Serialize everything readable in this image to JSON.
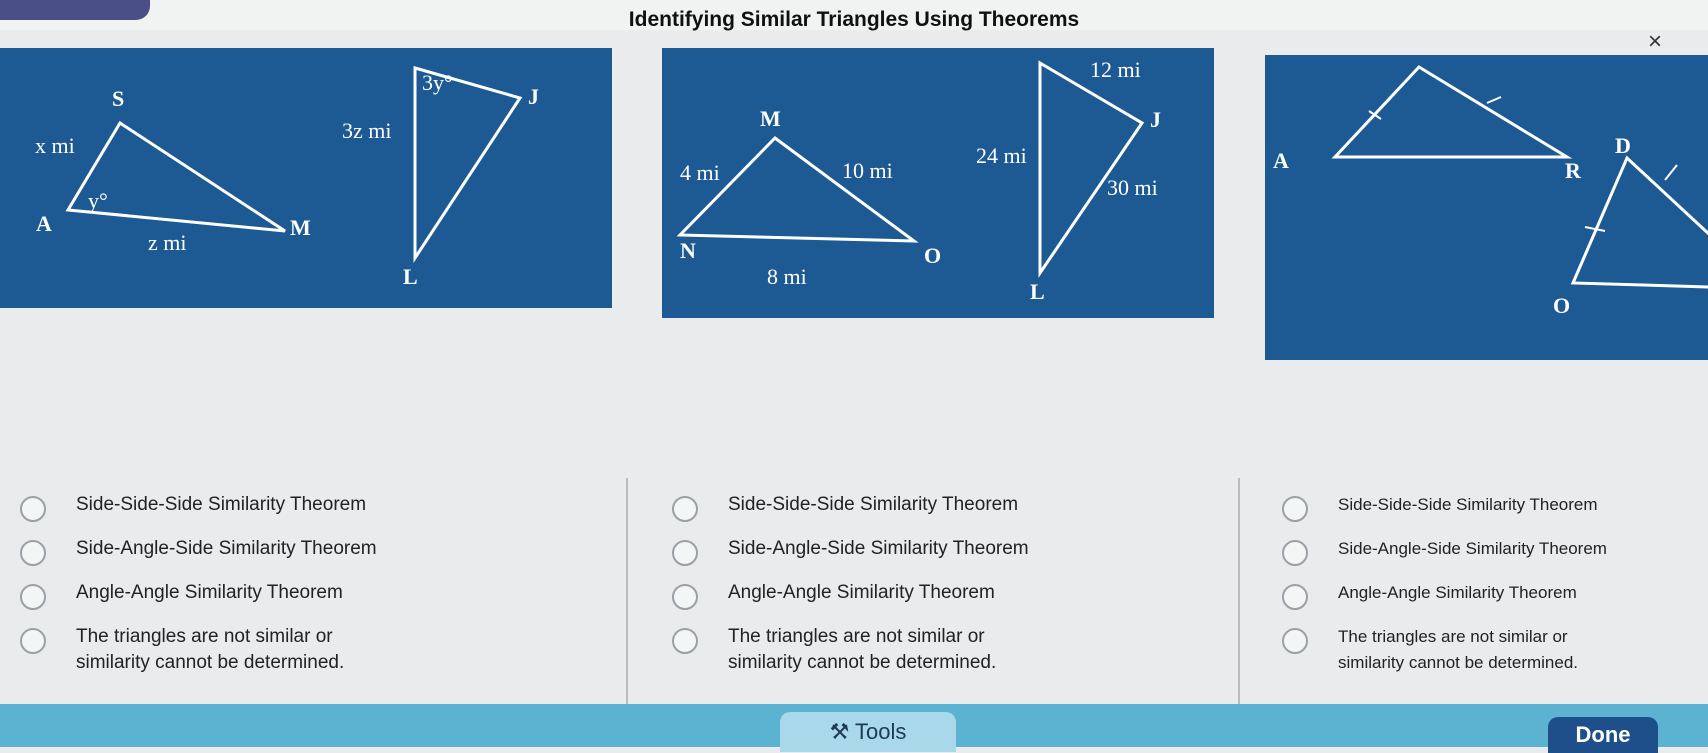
{
  "header": {
    "title": "Identifying Similar Triangles Using Theorems",
    "close_glyph": "×"
  },
  "figure1": {
    "tri_a": {
      "s": "S",
      "a": "A",
      "m": "M",
      "side_sa": "x mi",
      "side_am": "z mi",
      "angle_a": "y°"
    },
    "tri_b": {
      "j": "J",
      "l": "L",
      "angle_j": "3y°",
      "side_jl": "3z mi"
    }
  },
  "figure2": {
    "tri_a": {
      "m": "M",
      "n": "N",
      "o": "O",
      "side_mn": "4 mi",
      "side_mo": "10 mi",
      "side_no": "8 mi"
    },
    "tri_b": {
      "top": "12 mi",
      "j": "J",
      "l": "L",
      "side_left": "24 mi",
      "side_right": "30 mi"
    }
  },
  "figure3": {
    "a": "A",
    "r": "R",
    "d": "D",
    "o": "O"
  },
  "options": {
    "col1": [
      {
        "label": "Side-Side-Side Similarity Theorem"
      },
      {
        "label": "Side-Angle-Side Similarity Theorem"
      },
      {
        "label": "Angle-Angle Similarity Theorem"
      },
      {
        "label": "The triangles are not similar or\nsimilarity cannot be determined."
      }
    ],
    "col2": [
      {
        "label": "Side-Side-Side Similarity Theorem"
      },
      {
        "label": "Side-Angle-Side Similarity Theorem"
      },
      {
        "label": "Angle-Angle Similarity Theorem"
      },
      {
        "label": "The triangles are not similar or\nsimilarity cannot be determined."
      }
    ],
    "col3": [
      {
        "label": "Side-Side-Side Similarity Theorem"
      },
      {
        "label": "Side-Angle-Side Similarity Theorem"
      },
      {
        "label": "Angle-Angle Similarity Theorem"
      },
      {
        "label": "The triangles are not similar or\nsimilarity cannot be determined."
      }
    ]
  },
  "footer": {
    "tools_label": "Tools",
    "tools_icon": "wrench-icon",
    "done_label": "Done"
  },
  "colors": {
    "panel": "#1d5a93",
    "bottom_bar": "#5cb2d1",
    "done_button": "#1f4f8a"
  }
}
